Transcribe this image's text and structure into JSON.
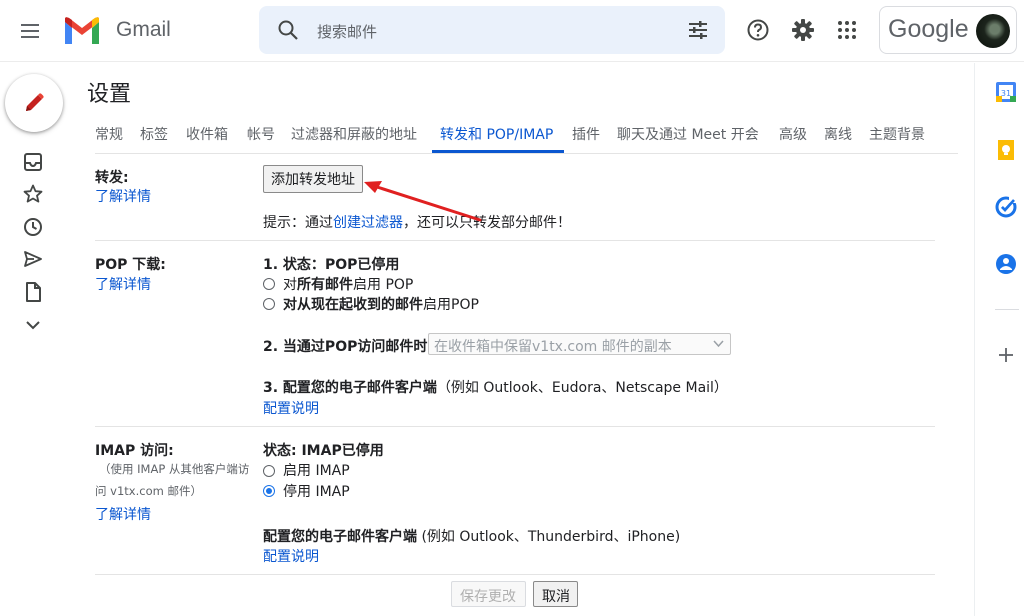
{
  "header": {
    "brand": "Gmail",
    "search_placeholder": "搜索邮件",
    "account_brand": "Google",
    "icons": [
      "menu-icon",
      "gmail-logo",
      "search-icon",
      "tune-icon",
      "help-icon",
      "gear-icon",
      "apps-grid-icon",
      "avatar"
    ]
  },
  "left_rail": {
    "icons": [
      "compose-pencil-icon",
      "inbox-icon",
      "star-icon",
      "clock-icon",
      "send-icon",
      "draft-icon",
      "chevron-down-icon"
    ]
  },
  "right_rail": {
    "icons": [
      "calendar-icon",
      "keep-icon",
      "tasks-icon",
      "contacts-icon",
      "plus-icon"
    ],
    "calendar_day": "31"
  },
  "settings": {
    "title": "设置",
    "tabs": [
      "常规",
      "标签",
      "收件箱",
      "帐号",
      "过滤器和屏蔽的地址",
      "转发和 POP/IMAP",
      "插件",
      "聊天及通过 Meet 开会",
      "高级",
      "离线",
      "主题背景"
    ],
    "active_tab": "转发和 POP/IMAP",
    "forwarding": {
      "label": "转发:",
      "learn_more": "了解详情",
      "add_button": "添加转发地址",
      "tip_prefix": "提示：通过",
      "tip_link": "创建过滤器",
      "tip_suffix": "，还可以只转发部分邮件！"
    },
    "pop": {
      "label": "POP 下载:",
      "learn_more": "了解详情",
      "status_prefix": "1. 状态：",
      "status": "POP已停用",
      "option1_pre": "对",
      "option1_bold": "所有邮件",
      "option1_post": "启用 POP",
      "option2_bold": "对从现在起收到的邮件",
      "option2_post": "启用POP",
      "when_label": "2. 当通过POP访问邮件时",
      "when_select": "在收件箱中保留v1tx.com 邮件的副本",
      "config_bold": "3. 配置您的电子邮件客户端",
      "config_rest": "（例如 Outlook、Eudora、Netscape Mail）",
      "config_link": "配置说明"
    },
    "imap": {
      "label": "IMAP 访问:",
      "sub_line1": "（使用 IMAP 从其他客户端访",
      "sub_line2": "问 v1tx.com 邮件）",
      "learn_more": "了解详情",
      "status": "状态: IMAP已停用",
      "enable": "启用 IMAP",
      "disable": "停用 IMAP",
      "selected": "停用 IMAP",
      "config_bold": "配置您的电子邮件客户端",
      "config_rest": " (例如 Outlook、Thunderbird、iPhone)",
      "config_link": "配置说明"
    },
    "save_button": "保存更改",
    "cancel_button": "取消"
  },
  "colors": {
    "accent": "#0b57d0",
    "annotation_arrow": "#e02020",
    "search_bg": "#eaf1fb"
  }
}
